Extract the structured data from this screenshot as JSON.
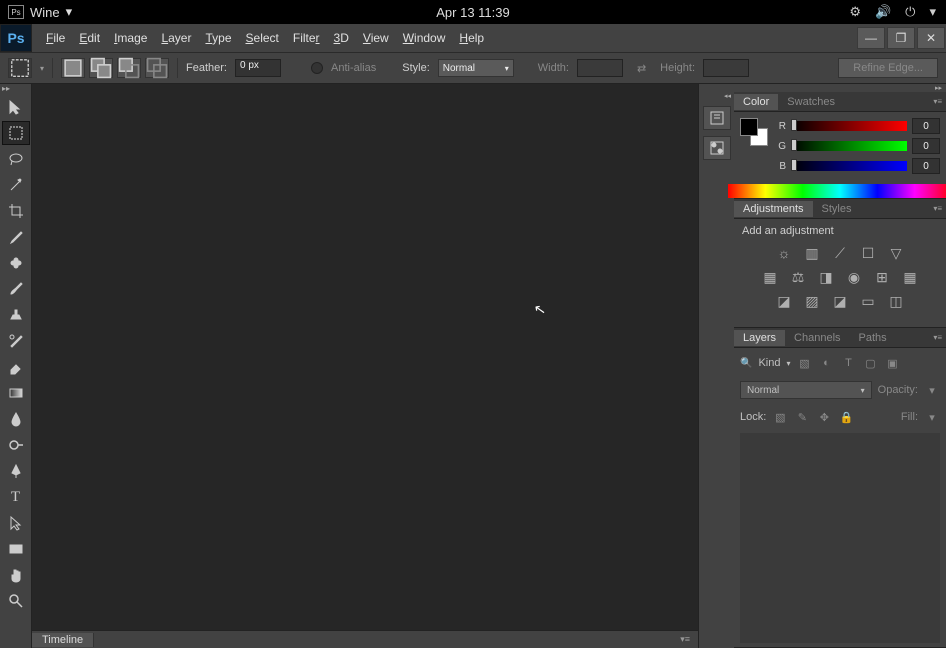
{
  "os": {
    "app_name": "Wine",
    "clock": "Apr 13  11:39",
    "tray": [
      "network-icon",
      "volume-icon",
      "power-icon",
      "dropdown-icon"
    ]
  },
  "app": {
    "logo": "Ps",
    "menu": [
      "File",
      "Edit",
      "Image",
      "Layer",
      "Type",
      "Select",
      "Filter",
      "3D",
      "View",
      "Window",
      "Help"
    ]
  },
  "options": {
    "feather_label": "Feather:",
    "feather_value": "0 px",
    "antialias_label": "Anti-alias",
    "style_label": "Style:",
    "style_value": "Normal",
    "width_label": "Width:",
    "height_label": "Height:",
    "refine_label": "Refine Edge..."
  },
  "timeline": {
    "tab": "Timeline"
  },
  "panels": {
    "color": {
      "tab_color": "Color",
      "tab_swatches": "Swatches",
      "r_label": "R",
      "g_label": "G",
      "b_label": "B",
      "r": "0",
      "g": "0",
      "b": "0"
    },
    "adjustments": {
      "tab_adjustments": "Adjustments",
      "tab_styles": "Styles",
      "add_label": "Add an adjustment"
    },
    "layers": {
      "tab_layers": "Layers",
      "tab_channels": "Channels",
      "tab_paths": "Paths",
      "kind_label": "Kind",
      "blend_mode": "Normal",
      "opacity_label": "Opacity:",
      "lock_label": "Lock:",
      "fill_label": "Fill:"
    }
  }
}
